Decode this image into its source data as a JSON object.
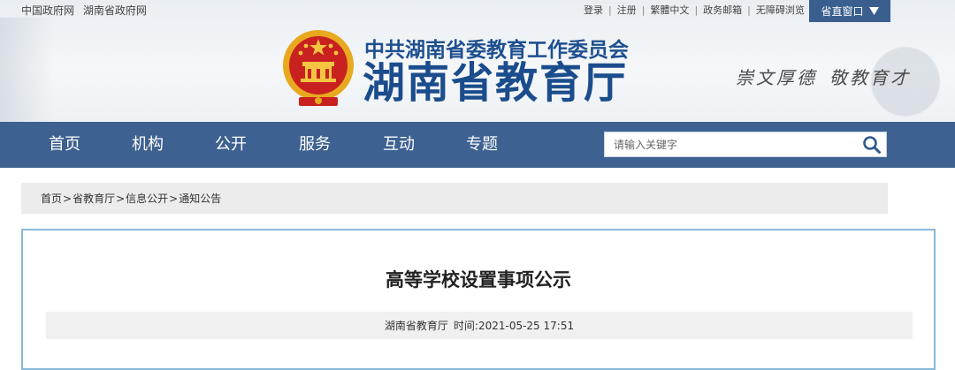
{
  "top_bar": {
    "left_links": [
      "中国政府网",
      "湖南省政府网"
    ],
    "right_links": [
      "登录",
      "注册",
      "繁體中文",
      "政务邮箱",
      "无障碍浏览"
    ],
    "dept_button": "省直窗口"
  },
  "header": {
    "subtitle": "中共湖南省委教育工作委员会",
    "title": "湖南省教育厅",
    "slogan_left": "崇文厚德",
    "slogan_right": "敬教育才"
  },
  "nav": {
    "items": [
      "首页",
      "机构",
      "公开",
      "服务",
      "互动",
      "专题"
    ],
    "search_placeholder": "请输入关键字"
  },
  "breadcrumb": [
    "首页",
    "省教育厅",
    "信息公开",
    "通知公告"
  ],
  "article": {
    "title": "高等学校设置事项公示",
    "source": "湖南省教育厅",
    "time_label": "时间:",
    "time": "2021-05-25 17:51"
  },
  "colors": {
    "nav_bg": "#3d6190",
    "title_blue": "#1b4c8c",
    "dept_button_bg": "#3a5f8f",
    "article_border": "#8ab8d8"
  },
  "icons": {
    "emblem": "national-emblem-icon",
    "search": "search-icon",
    "dropdown": "triangle-down-icon"
  }
}
